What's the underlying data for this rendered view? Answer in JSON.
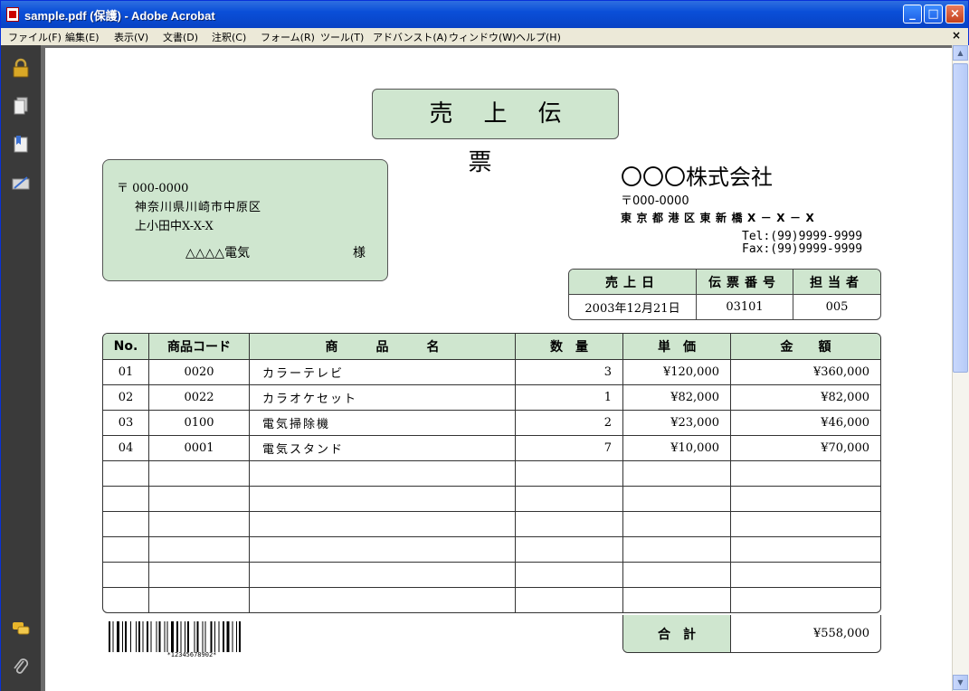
{
  "window": {
    "title": "sample.pdf (保護) - Adobe Acrobat",
    "min_label": "_",
    "max_label": "□",
    "close_label": "×"
  },
  "menu": [
    "ファイル(F)",
    "編集(E)",
    "表示(V)",
    "文書(D)",
    "注釈(C)",
    "フォーム(R)",
    "ツール(T)",
    "アドバンスト(A)",
    "ウィンドウ(W)",
    "ヘルプ(H)"
  ],
  "menu_close": "×",
  "sidebar_icons": [
    "lock-icon",
    "pages-icon",
    "bookmarks-icon",
    "signatures-icon",
    "comments-icon",
    "attachments-icon"
  ],
  "doc": {
    "title": "売上伝票",
    "recipient": {
      "postal": "〒 000-0000",
      "address1": "神奈川県川崎市中原区",
      "address2": "上小田中X-X-X",
      "name": "△△△△電気",
      "honorific": "様"
    },
    "company": {
      "name": "〇〇〇株式会社",
      "postal": "〒000-0000",
      "address": "東京都港区東新橋X－X－X",
      "tel": "Tel:(99)9999-9999",
      "fax": "Fax:(99)9999-9999"
    },
    "info": {
      "headers": [
        "売上日",
        "伝票番号",
        "担当者"
      ],
      "values": [
        "2003年12月21日",
        "03101",
        "005"
      ]
    },
    "items": {
      "headers": [
        "No.",
        "商品コード",
        "商　　　品　　　名",
        "数　量",
        "単　価",
        "金　　額"
      ],
      "rows": [
        [
          "01",
          "0020",
          "カラーテレビ",
          "3",
          "¥120,000",
          "¥360,000"
        ],
        [
          "02",
          "0022",
          "カラオケセット",
          "1",
          "¥82,000",
          "¥82,000"
        ],
        [
          "03",
          "0100",
          "電気掃除機",
          "2",
          "¥23,000",
          "¥46,000"
        ],
        [
          "04",
          "0001",
          "電気スタンド",
          "7",
          "¥10,000",
          "¥70,000"
        ],
        [
          "",
          "",
          "",
          "",
          "",
          ""
        ],
        [
          "",
          "",
          "",
          "",
          "",
          ""
        ],
        [
          "",
          "",
          "",
          "",
          "",
          ""
        ],
        [
          "",
          "",
          "",
          "",
          "",
          ""
        ],
        [
          "",
          "",
          "",
          "",
          "",
          ""
        ],
        [
          "",
          "",
          "",
          "",
          "",
          ""
        ]
      ]
    },
    "total": {
      "label": "合　計",
      "value": "¥558,000"
    },
    "barcode_text": "*12345678902*"
  }
}
